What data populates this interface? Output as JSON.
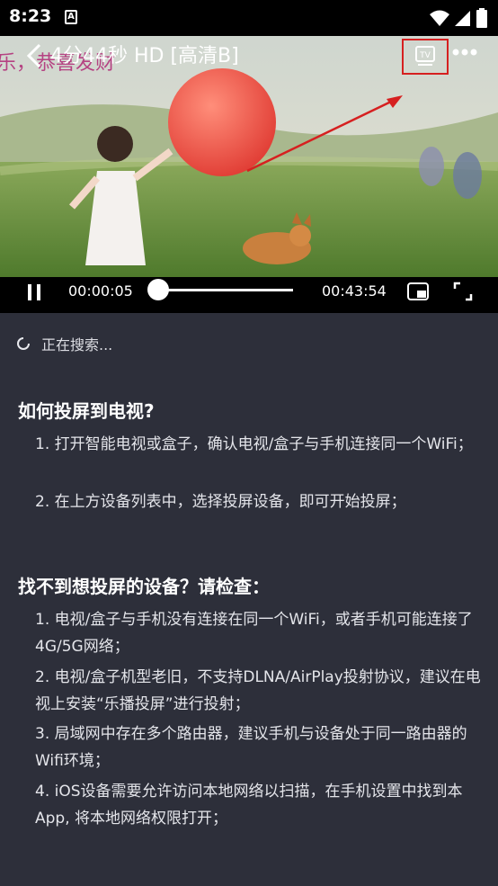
{
  "status_bar": {
    "time": "8:23",
    "app_icon": "A"
  },
  "video": {
    "overlay_text": "乐，恭喜发财",
    "title": "4分44秒 HD [高清B]",
    "tv_label": "TV"
  },
  "controls": {
    "current_time": "00:00:05",
    "total_time": "00:43:54",
    "progress": 0.002
  },
  "search": {
    "status": "正在搜索..."
  },
  "section1": {
    "title": "如何投屏到电视?",
    "items": [
      "1. 打开智能电视或盒子，确认电视/盒子与手机连接同一个WiFi；",
      "2. 在上方设备列表中，选择投屏设备，即可开始投屏；"
    ]
  },
  "section2": {
    "title": "找不到想投屏的设备？请检查：",
    "items": [
      "1. 电视/盒子与手机没有连接在同一个WiFi，或者手机可能连接了4G/5G网络；",
      "2. 电视/盒子机型老旧，不支持DLNA/AirPlay投射协议，建议在电视上安装“乐播投屏”进行投射；",
      "3. 局域网中存在多个路由器，建议手机与设备处于同一路由器的Wifi环境；",
      "4. iOS设备需要允许访问本地网络以扫描，在手机设置中找到本App, 将本地网络权限打开；"
    ]
  },
  "colors": {
    "background": "#2d2f3a",
    "highlight_box": "#d62020",
    "arrow": "#d62020"
  }
}
